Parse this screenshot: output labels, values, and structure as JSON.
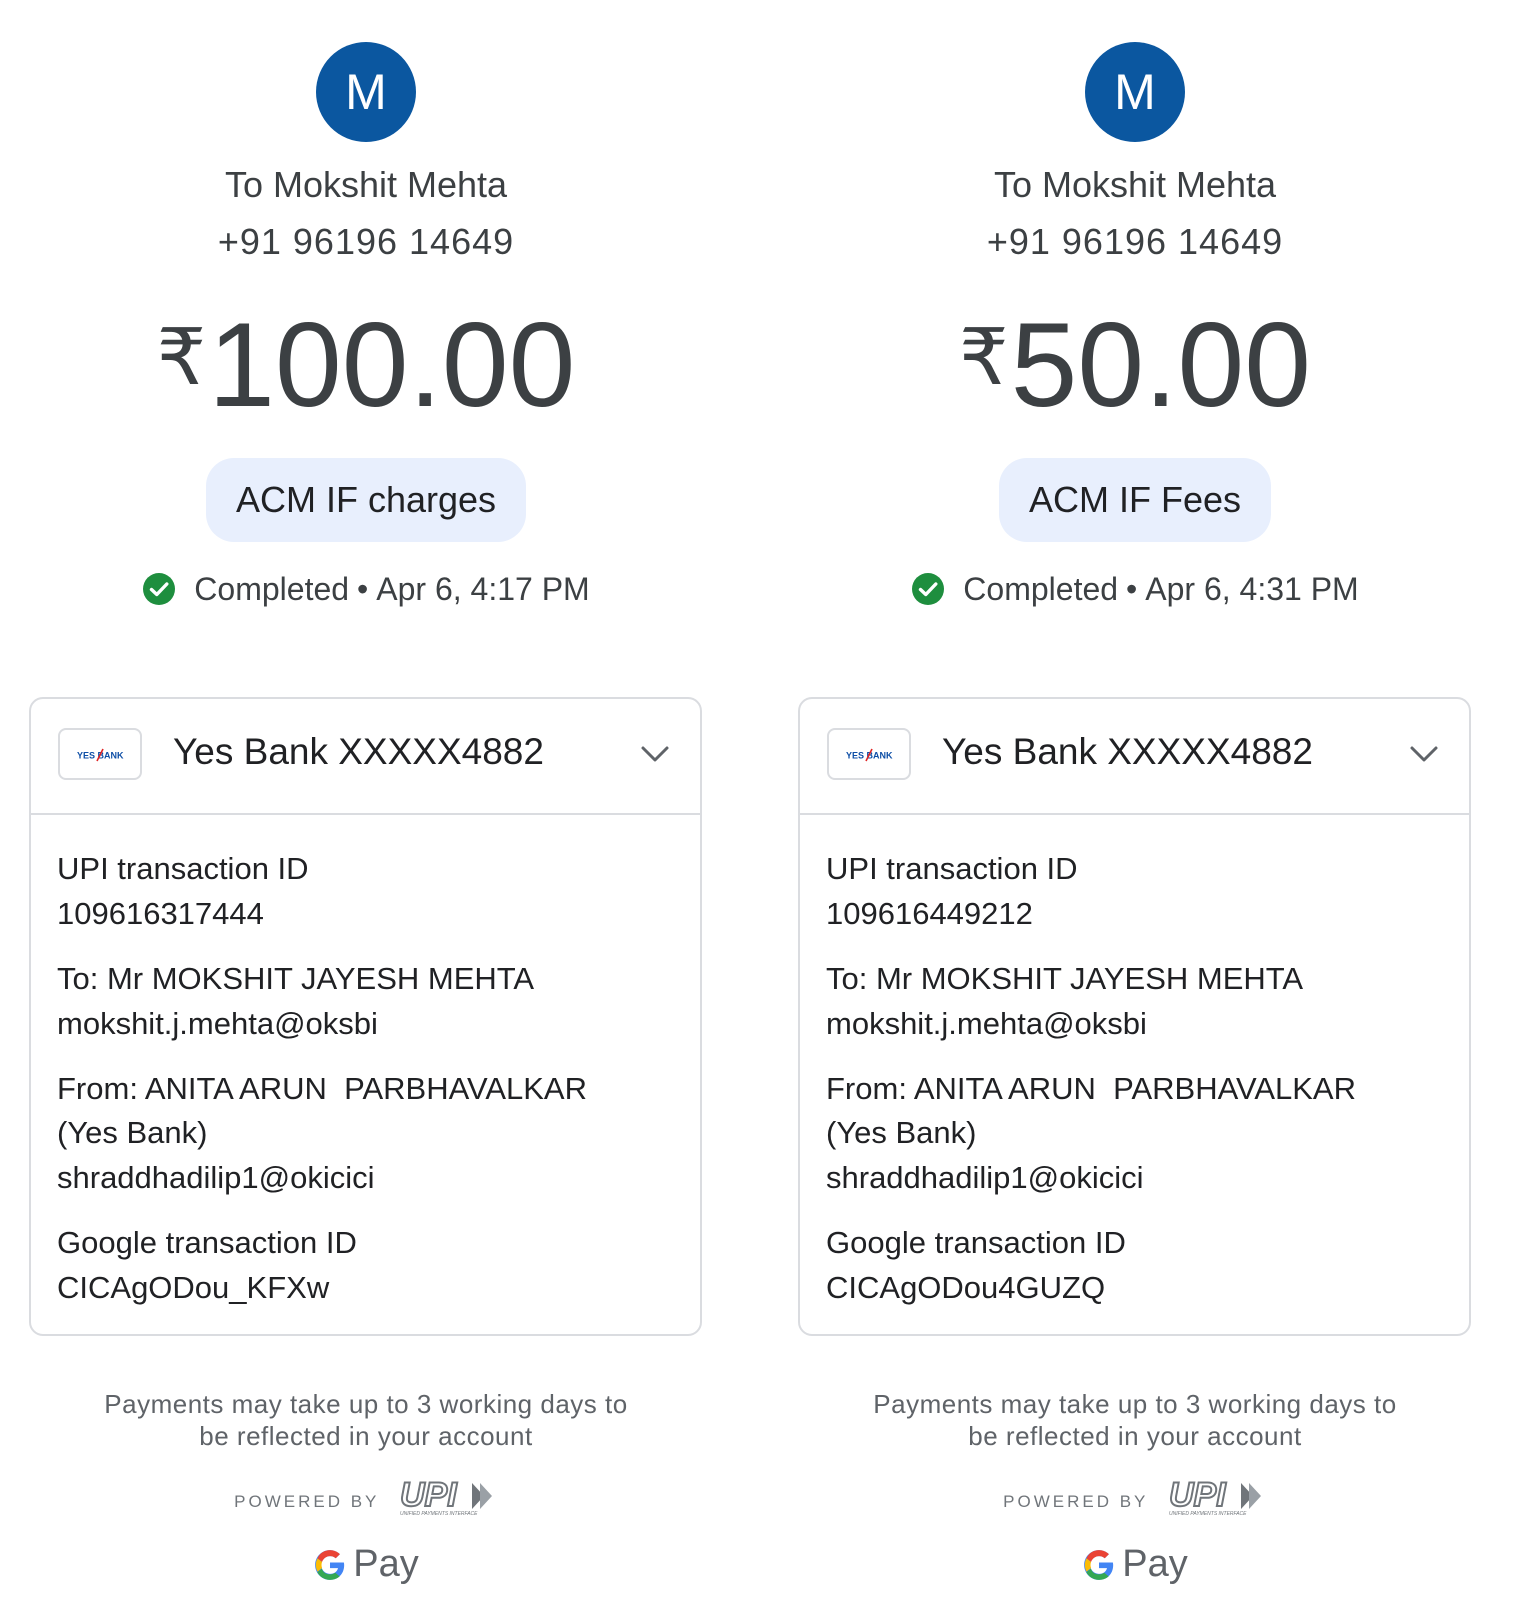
{
  "receipts": [
    {
      "avatar_letter": "M",
      "payee_line": "To Mokshit Mehta",
      "payee_phone": "+91 96196 14649",
      "currency_symbol": "₹",
      "amount": "100.00",
      "note": "ACM IF charges",
      "status": "Completed",
      "timestamp": "Apr 6, 4:17 PM",
      "bank_account": "Yes Bank XXXXX4882",
      "bank_logo_text": "YES BANK",
      "upi_txn_label": "UPI transaction ID",
      "upi_txn_id": "109616317444",
      "to_label": "To: Mr MOKSHIT JAYESH MEHTA",
      "to_vpa": "mokshit.j.mehta@oksbi",
      "from_label": "From: ANITA ARUN  PARBHAVALKAR",
      "from_bank": "(Yes Bank)",
      "from_vpa": "shraddhadilip1@okicici",
      "google_txn_label": "Google transaction ID",
      "google_txn_id": "CICAgODou_KFXw",
      "footer_line1": "Payments may take up to 3 working days to",
      "footer_line2": "be reflected in your account",
      "powered_by": "POWERED BY",
      "upi_logo_text": "UPI",
      "upi_logo_tagline": "UNIFIED PAYMENTS INTERFACE",
      "gpay_text": "Pay"
    },
    {
      "avatar_letter": "M",
      "payee_line": "To Mokshit Mehta",
      "payee_phone": "+91 96196 14649",
      "currency_symbol": "₹",
      "amount": "50.00",
      "note": "ACM IF Fees",
      "status": "Completed",
      "timestamp": "Apr 6, 4:31 PM",
      "bank_account": "Yes Bank XXXXX4882",
      "bank_logo_text": "YES BANK",
      "upi_txn_label": "UPI transaction ID",
      "upi_txn_id": "109616449212",
      "to_label": "To: Mr MOKSHIT JAYESH MEHTA",
      "to_vpa": "mokshit.j.mehta@oksbi",
      "from_label": "From: ANITA ARUN  PARBHAVALKAR",
      "from_bank": "(Yes Bank)",
      "from_vpa": "shraddhadilip1@okicici",
      "google_txn_label": "Google transaction ID",
      "google_txn_id": "CICAgODou4GUZQ",
      "footer_line1": "Payments may take up to 3 working days to",
      "footer_line2": "be reflected in your account",
      "powered_by": "POWERED BY",
      "upi_logo_text": "UPI",
      "upi_logo_tagline": "UNIFIED PAYMENTS INTERFACE",
      "gpay_text": "Pay"
    }
  ],
  "colors": {
    "avatar_bg": "#0b57a0",
    "chip_bg": "#e8effd",
    "success_green": "#1e8e3e",
    "border": "#dadce0",
    "text_primary": "#202124",
    "text_secondary": "#5f6368"
  },
  "icons": {
    "status": "check-circle-icon",
    "expand": "chevron-down-icon",
    "bank": "yes-bank-logo",
    "upi": "upi-logo",
    "google": "google-g-logo"
  }
}
